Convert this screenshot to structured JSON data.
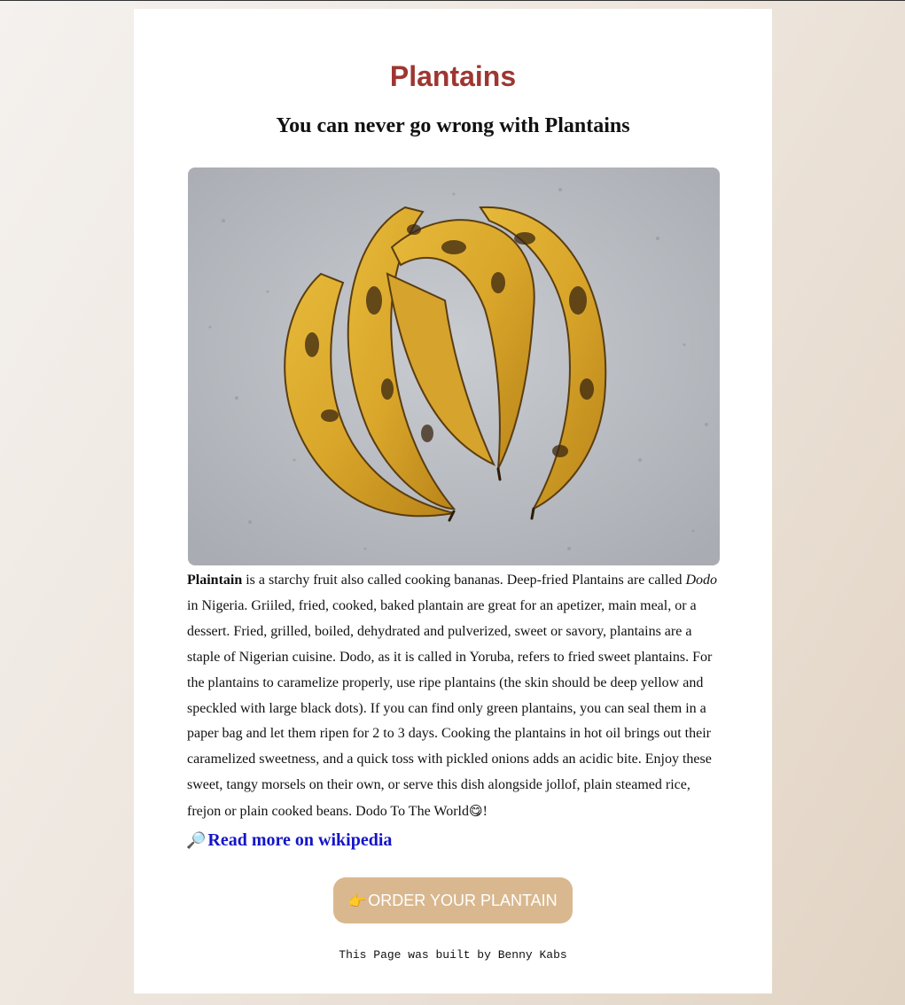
{
  "header": {
    "title": "Plantains",
    "subtitle": "You can never go wrong with Plantains"
  },
  "content": {
    "lead_bold": "Plaintain",
    "text_1": " is a starchy fruit also called cooking bananas. Deep-fried Plantains are called ",
    "italic_word": "Dodo",
    "text_2": " in Nigeria. Griiled, fried, cooked, baked plantain are great for an apetizer, main meal, or a dessert. Fried, grilled, boiled, dehydrated and pulverized, sweet or savory, plantains are a staple of Nigerian cuisine. Dodo, as it is called in Yoruba, refers to fried sweet plantains. For the plantains to caramelize properly, use ripe plantains (the skin should be deep yellow and speckled with large black dots). If you can find only green plantains, you can seal them in a paper bag and let them ripen for 2 to 3 days. Cooking the plantains in hot oil brings out their caramelized sweetness, and a quick toss with pickled onions adds an acidic bite. Enjoy these sweet, tangy morsels on their own, or serve this dish alongside jollof, plain steamed rice, frejon or plain cooked beans. Dodo To The World",
    "emoji": "😋",
    "text_end": "!"
  },
  "wiki_link": {
    "icon": "magnifier-icon",
    "label": "Read more on wikipedia"
  },
  "order_button": {
    "icon": "pointing-hand-icon",
    "label": "ORDER YOUR PLANTAIN"
  },
  "footer": {
    "text": "This Page was built by Benny Kabs"
  },
  "colors": {
    "title": "#9e3631",
    "link": "#1414c8",
    "button": "#d9b88f"
  }
}
